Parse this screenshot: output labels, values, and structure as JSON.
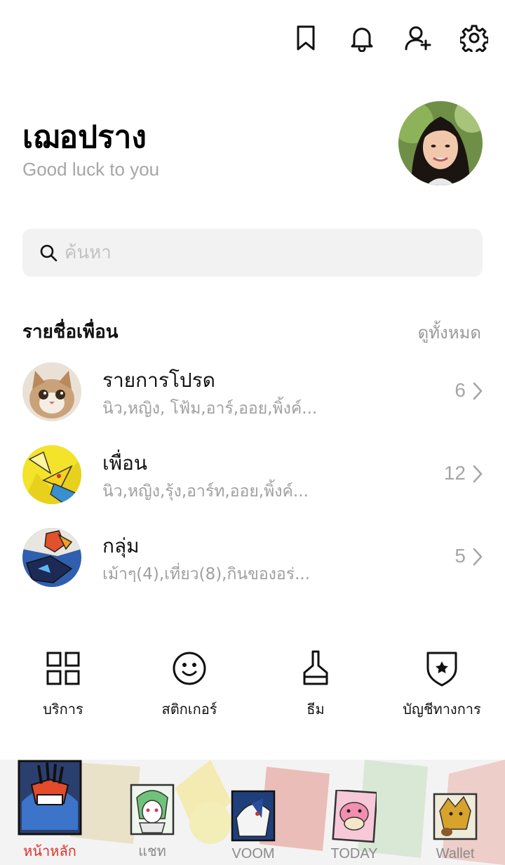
{
  "header": {
    "icons": [
      "bookmark-icon",
      "bell-icon",
      "add-friend-icon",
      "gear-icon"
    ]
  },
  "profile": {
    "name": "เฌอปราง",
    "status": "Good luck to you"
  },
  "search": {
    "placeholder": "ค้นหา"
  },
  "friends_section": {
    "title": "รายชื่อเพื่อน",
    "see_all": "ดูทั้งหมด",
    "rows": [
      {
        "title": "รายการโปรด",
        "subtitle": "นิว,หญิง, โฟ้ม,อาร์,ออย,พิ้งค์...",
        "count": "6"
      },
      {
        "title": "เพื่อน",
        "subtitle": "นิว,หญิง,รุ้ง,อาร์ท,ออย,พิ้งค์...",
        "count": "12"
      },
      {
        "title": "กลุ่ม",
        "subtitle": "เม้าๆ(4),เที่ยว(8),กินของอร่...",
        "count": "5"
      }
    ]
  },
  "shortcuts": [
    {
      "label": "บริการ",
      "icon": "grid-icon"
    },
    {
      "label": "สติกเกอร์",
      "icon": "smiley-icon"
    },
    {
      "label": "ธีม",
      "icon": "brush-icon"
    },
    {
      "label": "บัญชีทางการ",
      "icon": "shield-star-icon"
    }
  ],
  "bottom_nav": [
    {
      "label": "หน้าหลัก",
      "active": true
    },
    {
      "label": "แชท",
      "active": false
    },
    {
      "label": "VOOM",
      "active": false
    },
    {
      "label": "TODAY",
      "active": false
    },
    {
      "label": "Wallet",
      "active": false
    }
  ],
  "colors": {
    "active_tab": "#e0302a",
    "muted_text": "#a0a0a0",
    "search_bg": "#f2f2f2"
  }
}
